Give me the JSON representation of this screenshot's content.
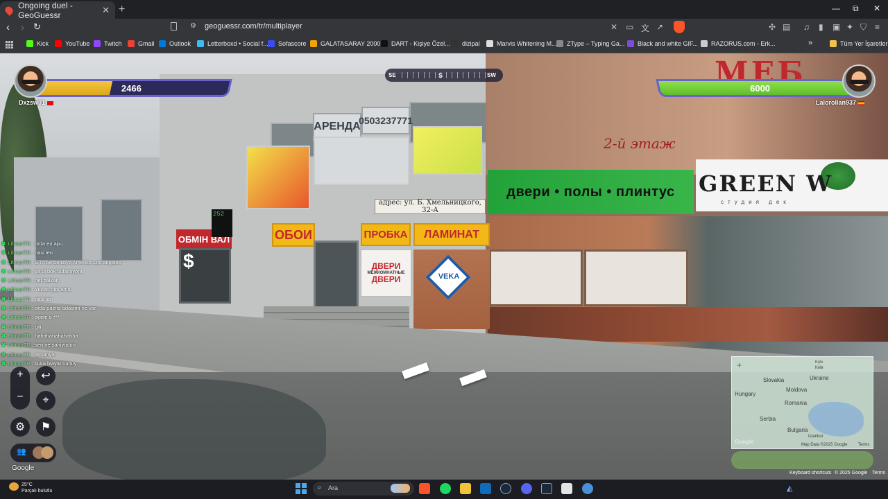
{
  "browser": {
    "tab_title": "Ongoing duel - GeoGuessr",
    "tab_close": "✕",
    "new_tab": "+",
    "url": "geoguessr.com/tr/multiplayer",
    "window": {
      "minimize": "—",
      "restore": "⧉",
      "close": "✕"
    },
    "bookmarks": [
      {
        "label": "Kick",
        "color": "#53fc18"
      },
      {
        "label": "YouTube",
        "color": "#ff0000"
      },
      {
        "label": "Twitch",
        "color": "#9146ff"
      },
      {
        "label": "Gmail",
        "color": "#ea4335"
      },
      {
        "label": "Outlook",
        "color": "#0078d4"
      },
      {
        "label": "Letterboxd • Social f...",
        "color": "#40bcf4"
      },
      {
        "label": "Sofascore",
        "color": "#374df5"
      },
      {
        "label": "GALATASARAY 2000...",
        "color": "#f4a300"
      },
      {
        "label": "DART - Kişiye Özel...",
        "color": "#111111"
      },
      {
        "label": "dizipal",
        "color": "#333333"
      },
      {
        "label": "Marvis Whitening M...",
        "color": "#dddddd"
      },
      {
        "label": "ZType – Typing Ga...",
        "color": "#888888"
      },
      {
        "label": "Black and white GIF...",
        "color": "#7a4fd1"
      },
      {
        "label": "RAZORUS.com - Erk...",
        "color": "#cccccc"
      }
    ],
    "bookmarks_overflow": "»",
    "all_bookmarks": "Tüm Yer İşaretleri"
  },
  "hud": {
    "compass": {
      "left": "SE",
      "center": "S",
      "right": "SW"
    },
    "player_left": {
      "name": "Dxzsw01",
      "health": "2466",
      "health_fraction": 0.41,
      "flag_color": "#e30a17"
    },
    "player_right": {
      "name": "Lalorollan937",
      "health": "6000",
      "health_fraction": 1.0,
      "flag_color": "#f1bf00"
    }
  },
  "chat": [
    {
      "user": "LifmanTR",
      "text": "orda en apu"
    },
    {
      "user": "LifmanTR",
      "text": "nasi len"
    },
    {
      "user": "LifmanTR",
      "text": "GTA 5e benziyo Amerika Los angales"
    },
    {
      "user": "LifmanTR",
      "text": "ya bi bok bulamiyom"
    },
    {
      "user": "LifmanTR",
      "text": "net balkan"
    },
    {
      "user": "LifmanTR",
      "text": "Yunan gibi ama"
    },
    {
      "user": "LifmanTR",
      "text": "nasi lan"
    },
    {
      "user": "LifmanTR",
      "text": "orda palma adasimi ne var"
    },
    {
      "user": "LifmanTR",
      "text": "ayem o ***"
    },
    {
      "user": "LifmanTR",
      "text": "gili"
    },
    {
      "user": "LifmanTR",
      "text": "hahahahahahahha"
    },
    {
      "user": "LifmanTR",
      "text": "sen ne saniyodun"
    },
    {
      "user": "LifmanTR",
      "text": "almanya"
    },
    {
      "user": "LifmanTR",
      "text": "suka blayat nahuy"
    }
  ],
  "controls": {
    "zoom_in": "+",
    "zoom_out": "−",
    "undo": "↩",
    "google": "Google"
  },
  "street_signs": {
    "arenda": "АРЕНДА",
    "phone": "0503237771",
    "address": "адрес: ул. Б. Хмельницкого, 32-А",
    "oboi": "ОБОИ",
    "probka": "ПРОБКА",
    "laminat": "ЛАМИНАТ",
    "dveri": "ДВЕРИ",
    "dveri_sub": "МЕЖКОМНАТНЫЕ",
    "dveri2": "ДВЕРИ",
    "exchange": "ОБМІН ВАЛ",
    "dollar": "$",
    "veka": "VEKA",
    "green_sign": "двери • полы • плинтус",
    "green_w": "GREEN W",
    "studio": "студия дек",
    "mebel": "МЕБ",
    "etazh": "2-й этаж",
    "led": "252"
  },
  "minimap": {
    "labels": [
      "Kyiv",
      "Київ",
      "Slovakia",
      "Ukraine",
      "Moldova",
      "Hungary",
      "Romania",
      "Serbia",
      "Bulgaria",
      "Istanbul"
    ],
    "attribution": "Map Data ©2025 Google",
    "terms": "Terms",
    "google": "Google"
  },
  "footer": {
    "shortcuts": "Keyboard shortcuts",
    "copyright": "© 2025 Google",
    "terms": "Terms"
  },
  "taskbar": {
    "weather_temp": "25°C",
    "weather_desc": "Parçalı bulutlu",
    "search_placeholder": "Ara"
  }
}
